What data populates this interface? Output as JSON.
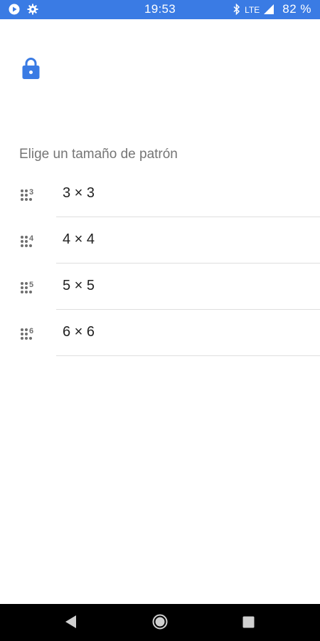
{
  "status_bar": {
    "time": "19:53",
    "network": "LTE",
    "battery": "82 %",
    "icons": [
      "play-store-icon",
      "gear-icon",
      "bluetooth-icon",
      "signal-icon"
    ]
  },
  "screen": {
    "title": "Elige un tamaño de patrón"
  },
  "pattern_sizes": [
    {
      "label": "3 × 3",
      "badge": "3"
    },
    {
      "label": "4 × 4",
      "badge": "4"
    },
    {
      "label": "5 × 5",
      "badge": "5"
    },
    {
      "label": "6 × 6",
      "badge": "6"
    }
  ],
  "colors": {
    "accent": "#3a7be4",
    "text_secondary": "#757575",
    "text_primary": "#212121",
    "icon_gray": "#6e6e6e"
  },
  "nav_bar": {
    "buttons": [
      "back-icon",
      "home-icon",
      "recents-icon"
    ]
  }
}
